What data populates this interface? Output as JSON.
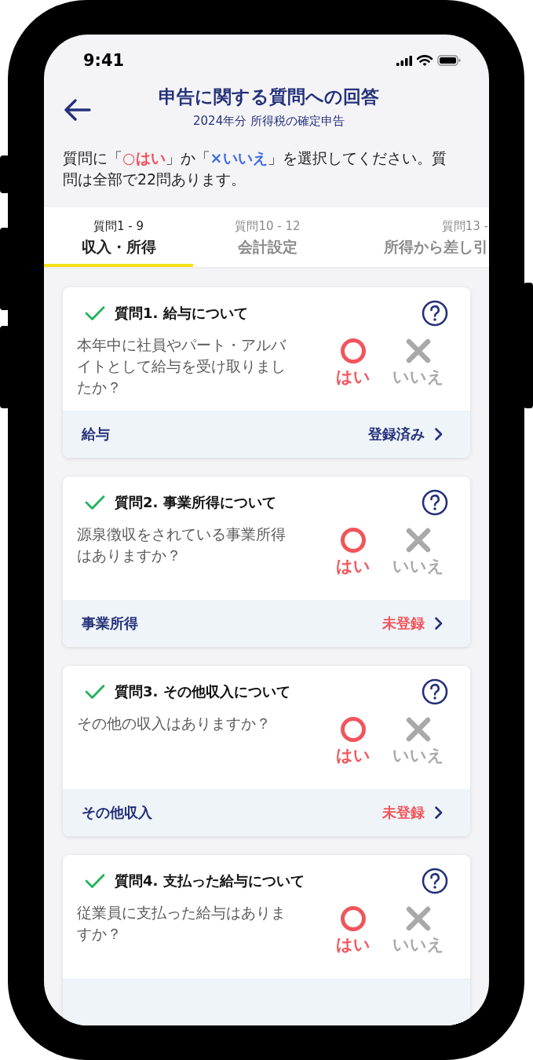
{
  "status_bar": {
    "time": "9:41"
  },
  "header": {
    "title": "申告に関する質問への回答",
    "subtitle": "2024年分 所得税の確定申告"
  },
  "instruction": [
    {
      "text": "質問に「"
    },
    {
      "text": "○はい",
      "kind": "yes"
    },
    {
      "text": "」か「"
    },
    {
      "text": "×いいえ",
      "kind": "no"
    },
    {
      "text": "」を選択してください。質問は全部で22問あります。"
    }
  ],
  "tabs": [
    {
      "range": "質問1 - 9",
      "label": "収入・所得",
      "selected": true
    },
    {
      "range": "質問10 - 12",
      "label": "会計設定",
      "selected": false
    },
    {
      "range": "質問13 -",
      "label": "所得から差し引",
      "selected": false
    }
  ],
  "questions": [
    {
      "title": "質問1. 給与について",
      "answered": true,
      "text": "本年中に社員やパート・アルバイトとして給与を受け取りましたか？",
      "options": [
        {
          "kind": "yes",
          "label": "はい",
          "selected": true
        },
        {
          "kind": "no",
          "label": "いいえ",
          "selected": false
        }
      ],
      "footer": {
        "label": "給与",
        "status": "登録済み",
        "registered": true
      }
    },
    {
      "title": "質問2. 事業所得について",
      "answered": true,
      "text": "源泉徴収をされている事業所得はありますか？",
      "options": [
        {
          "kind": "yes",
          "label": "はい",
          "selected": true
        },
        {
          "kind": "no",
          "label": "いいえ",
          "selected": false
        }
      ],
      "footer": {
        "label": "事業所得",
        "status": "未登録",
        "registered": false
      }
    },
    {
      "title": "質問3. その他収入について",
      "answered": true,
      "text": "その他の収入はありますか？",
      "options": [
        {
          "kind": "yes",
          "label": "はい",
          "selected": true
        },
        {
          "kind": "no",
          "label": "いいえ",
          "selected": false
        }
      ],
      "footer": {
        "label": "その他収入",
        "status": "未登録",
        "registered": false
      }
    },
    {
      "title": "質問4. 支払った給与について",
      "answered": true,
      "text": "従業員に支払った給与はありますか？",
      "options": [
        {
          "kind": "yes",
          "label": "はい",
          "selected": true
        },
        {
          "kind": "no",
          "label": "いいえ",
          "selected": false
        }
      ]
    }
  ]
}
